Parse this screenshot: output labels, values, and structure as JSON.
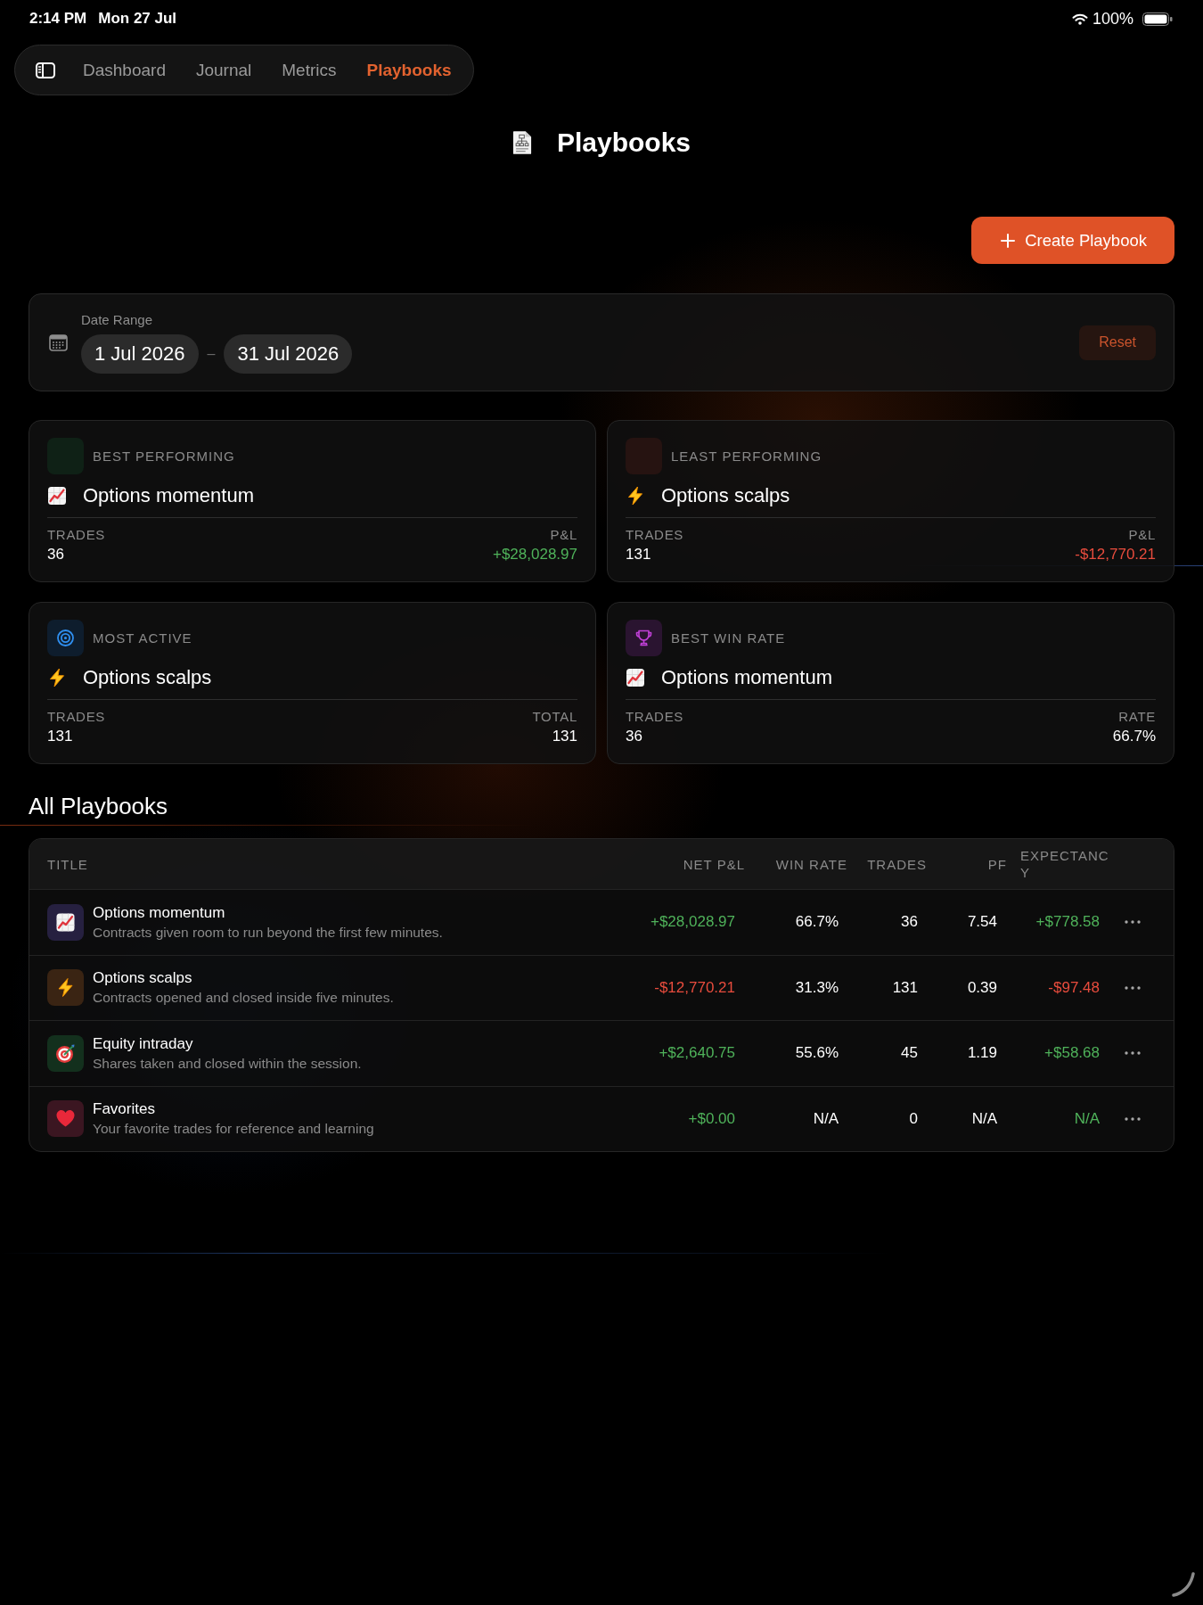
{
  "status_bar": {
    "time": "2:14 PM",
    "date": "Mon 27 Jul",
    "battery": "100%"
  },
  "nav": {
    "tabs": [
      {
        "label": "Dashboard",
        "selected": false
      },
      {
        "label": "Journal",
        "selected": false
      },
      {
        "label": "Metrics",
        "selected": false
      },
      {
        "label": "Playbooks",
        "selected": true
      }
    ]
  },
  "header": {
    "title": "Playbooks",
    "create_button": "Create Playbook"
  },
  "date_range": {
    "label": "Date Range",
    "start": "1 Jul 2026",
    "separator": "–",
    "end": "31 Jul 2026",
    "reset": "Reset"
  },
  "highlights": [
    {
      "kind": "best",
      "label": "BEST PERFORMING",
      "playbook": {
        "kind": "momentum",
        "name": "Options momentum"
      },
      "stats": [
        {
          "label": "TRADES",
          "value": "36",
          "color": "#ffffff"
        },
        {
          "label": "P&L",
          "value": "+$28,028.97",
          "color": "#4fb25a"
        }
      ]
    },
    {
      "kind": "least",
      "label": "LEAST PERFORMING",
      "playbook": {
        "kind": "scalp",
        "name": "Options scalps"
      },
      "stats": [
        {
          "label": "TRADES",
          "value": "131",
          "color": "#ffffff"
        },
        {
          "label": "P&L",
          "value": "-$12,770.21",
          "color": "#e84c3d"
        }
      ]
    },
    {
      "kind": "active",
      "label": "MOST ACTIVE",
      "playbook": {
        "kind": "scalp",
        "name": "Options scalps"
      },
      "stats": [
        {
          "label": "TRADES",
          "value": "131",
          "color": "#ffffff"
        },
        {
          "label": "TOTAL",
          "value": "131",
          "color": "#ffffff"
        }
      ]
    },
    {
      "kind": "win_rate",
      "label": "BEST WIN RATE",
      "playbook": {
        "kind": "momentum",
        "name": "Options momentum"
      },
      "stats": [
        {
          "label": "TRADES",
          "value": "36",
          "color": "#ffffff"
        },
        {
          "label": "RATE",
          "value": "66.7%",
          "color": "#ffffff"
        }
      ]
    }
  ],
  "table": {
    "title": "All Playbooks",
    "columns": [
      "TITLE",
      "NET P&L",
      "WIN RATE",
      "TRADES",
      "PF",
      "EXPECTANCY"
    ],
    "rows": [
      {
        "kind": "momentum",
        "name": "Options momentum",
        "description": "Contracts given room to run beyond the first few minutes.",
        "net_pnl": {
          "value": "+$28,028.97",
          "color": "#4fb25a"
        },
        "win_rate": "66.7%",
        "trades": "36",
        "pf": "7.54",
        "expectancy": {
          "value": "+$778.58",
          "color": "#4fb25a"
        }
      },
      {
        "kind": "scalp",
        "name": "Options scalps",
        "description": "Contracts opened and closed inside five minutes.",
        "net_pnl": {
          "value": "-$12,770.21",
          "color": "#e84c3d"
        },
        "win_rate": "31.3%",
        "trades": "131",
        "pf": "0.39",
        "expectancy": {
          "value": "-$97.48",
          "color": "#e84c3d"
        }
      },
      {
        "kind": "intraday",
        "name": "Equity intraday",
        "description": "Shares taken and closed within the session.",
        "net_pnl": {
          "value": "+$2,640.75",
          "color": "#4fb25a"
        },
        "win_rate": "55.6%",
        "trades": "45",
        "pf": "1.19",
        "expectancy": {
          "value": "+$58.68",
          "color": "#4fb25a"
        }
      },
      {
        "kind": "favorites",
        "name": "Favorites",
        "description": "Your favorite trades for reference and learning",
        "net_pnl": {
          "value": "+$0.00",
          "color": "#4fb25a"
        },
        "win_rate": "N/A",
        "trades": "0",
        "pf": "N/A",
        "expectancy": {
          "value": "N/A",
          "color": "#4fb25a"
        }
      }
    ]
  }
}
